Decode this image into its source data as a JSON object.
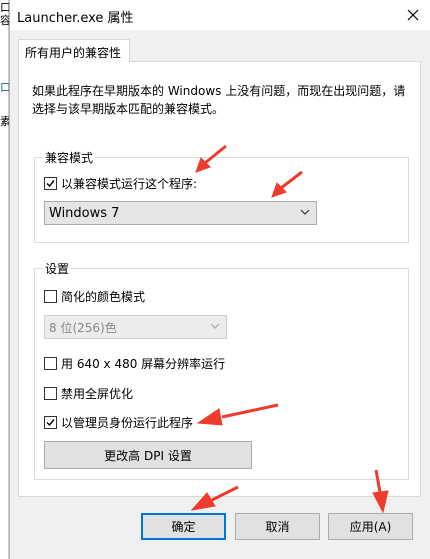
{
  "background_window": {
    "glyphs": [
      "口",
      "容",
      "口",
      "素"
    ]
  },
  "dialog": {
    "title": "Launcher.exe 属性",
    "close_icon": "close-icon"
  },
  "tabs": [
    {
      "label": "所有用户的兼容性"
    }
  ],
  "description": "如果此程序在早期版本的 Windows 上没有问题，而现在出现问题，请选择与该早期版本匹配的兼容模式。",
  "compat_mode": {
    "legend": "兼容模式",
    "checkbox_label": "以兼容模式运行这个程序:",
    "checked": true,
    "selected_os": "Windows 7"
  },
  "settings": {
    "legend": "设置",
    "reduced_color_label": "简化的颜色模式",
    "reduced_color_checked": false,
    "color_depth_value": "8 位(256)色",
    "resolution_label": "用 640 x 480 屏幕分辨率运行",
    "resolution_checked": false,
    "fullscreen_opt_label": "禁用全屏优化",
    "fullscreen_opt_checked": false,
    "admin_label": "以管理员身份运行此程序",
    "admin_checked": true,
    "dpi_button_label": "更改高 DPI 设置"
  },
  "footer": {
    "ok_label": "确定",
    "cancel_label": "取消",
    "apply_label": "应用(A)"
  },
  "colors": {
    "annotation_arrow": "#f03a2e",
    "default_button_border": "#0078d7"
  }
}
